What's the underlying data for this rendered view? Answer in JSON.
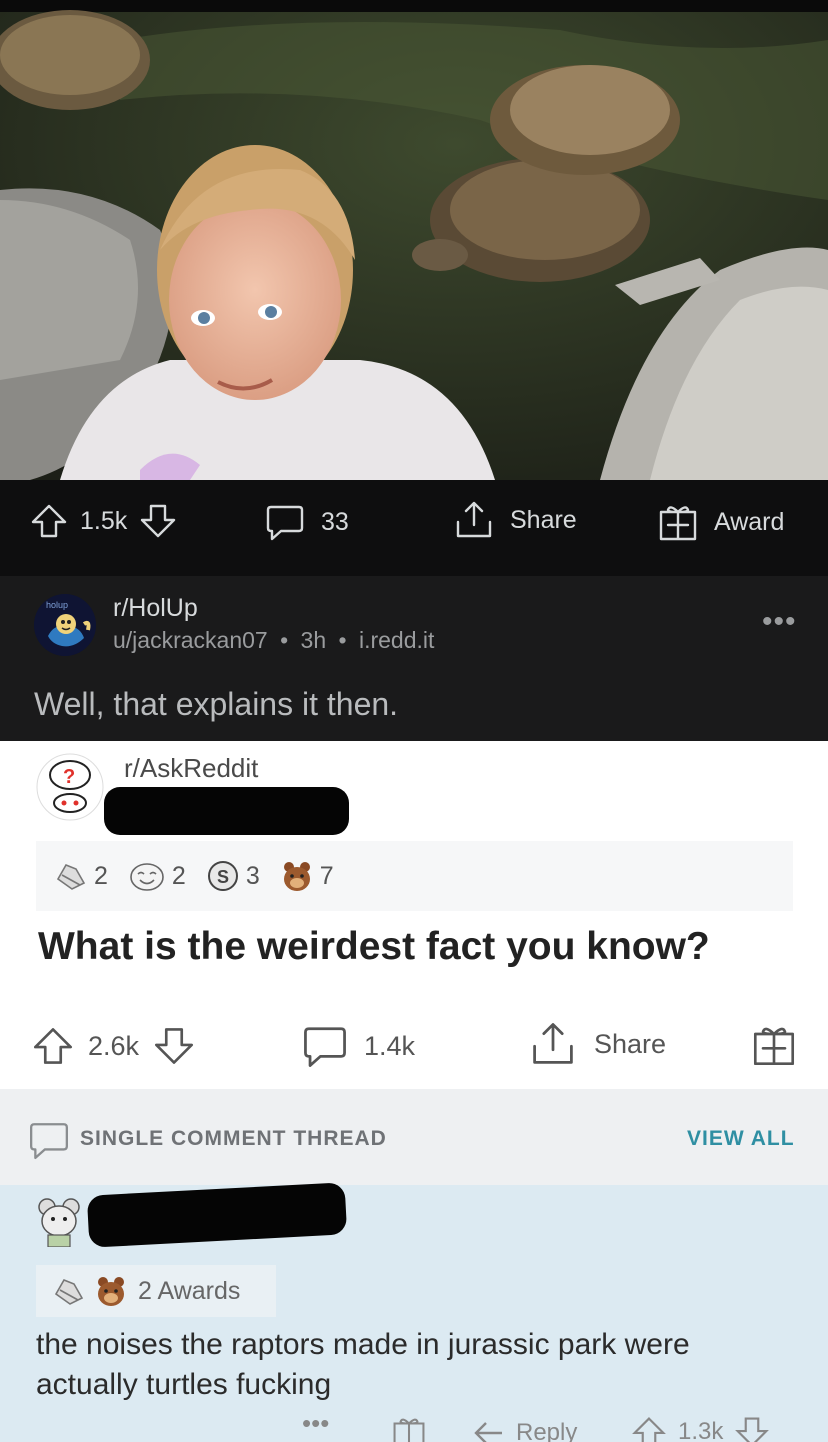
{
  "top_post": {
    "upvotes": "1.5k",
    "comments": "33",
    "share_label": "Share",
    "award_label": "Award",
    "subreddit": "r/HolUp",
    "subreddit_avatar_text": "holup",
    "author": "u/jackrackan07",
    "age": "3h",
    "domain": "i.redd.it",
    "separator": "•",
    "more": "•••",
    "title": "Well, that explains it then."
  },
  "embedded_post": {
    "subreddit": "r/AskReddit",
    "awards": [
      {
        "icon": "wholesome-award-icon",
        "count": "2"
      },
      {
        "icon": "laughing-award-icon",
        "count": "2"
      },
      {
        "icon": "silver-award-icon",
        "count": "3"
      },
      {
        "icon": "bear-award-icon",
        "count": "7"
      }
    ],
    "title": "What is the weirdest fact you know?",
    "upvotes": "2.6k",
    "comments": "1.4k",
    "share_label": "Share"
  },
  "thread": {
    "label": "SINGLE COMMENT THREAD",
    "view_all": "VIEW ALL"
  },
  "comment": {
    "awards_label": "2 Awards",
    "text": "the noises the raptors made in jurassic park were actually turtles fucking",
    "reply_label": "Reply",
    "votes": "1.3k"
  },
  "colors": {
    "dark_bg": "#1a1a1b",
    "accent_teal": "#2f8fa3",
    "comment_bg": "#dceaf2"
  }
}
